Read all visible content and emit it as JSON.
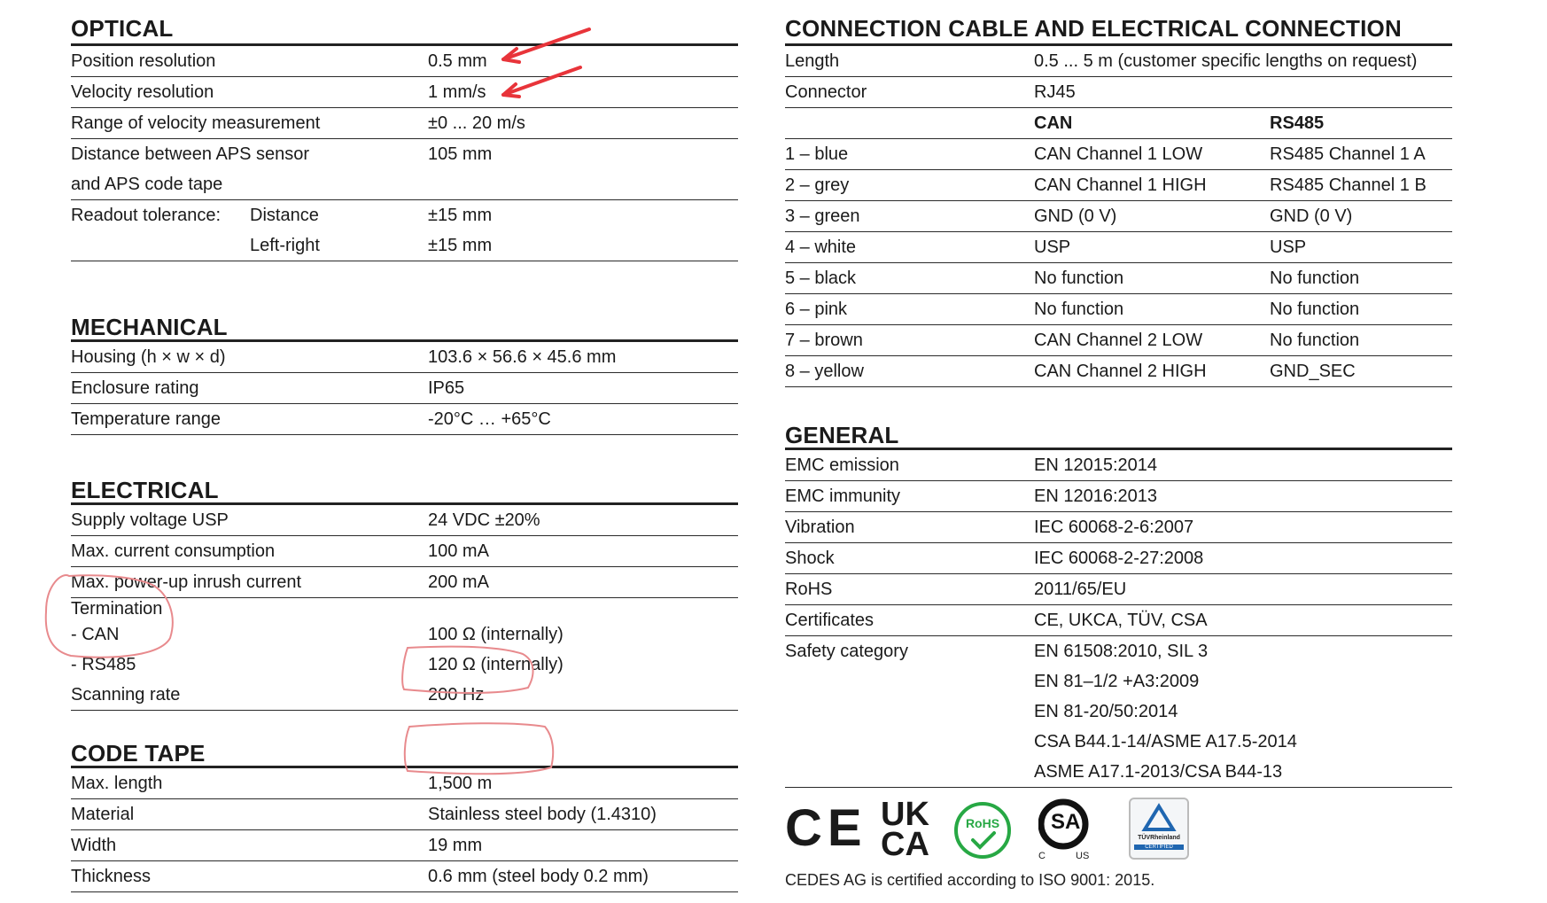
{
  "optical": {
    "title": "OPTICAL",
    "rows": [
      {
        "label": "Position resolution",
        "value": "0.5 mm"
      },
      {
        "label": "Velocity resolution",
        "value": "1 mm/s"
      },
      {
        "label": "Range of velocity measurement",
        "value": "±0 ... 20 m/s"
      },
      {
        "label_line1": "Distance between APS sensor",
        "label_line2": "and APS code tape",
        "value": "105 mm"
      }
    ],
    "readout": {
      "label": "Readout tolerance:",
      "sub1": "Distance",
      "val1": "±15 mm",
      "sub2": "Left-right",
      "val2": "±15 mm"
    }
  },
  "mechanical": {
    "title": "MECHANICAL",
    "rows": [
      {
        "label": "Housing (h × w × d)",
        "value": "103.6 × 56.6 × 45.6 mm"
      },
      {
        "label": "Enclosure rating",
        "value": "IP65"
      },
      {
        "label": "Temperature range",
        "value": "-20°C … +65°C"
      }
    ]
  },
  "electrical": {
    "title": "ELECTRICAL",
    "rows": [
      {
        "label": "Supply voltage USP",
        "value": "24 VDC ±20%"
      },
      {
        "label": "Max. current consumption",
        "value": "100 mA"
      },
      {
        "label": "Max. power-up inrush current",
        "value": "200 mA"
      }
    ],
    "termination": {
      "label": "Termination",
      "can_label": "- CAN",
      "can_value": "100 Ω (internally)",
      "rs_label": "- RS485",
      "rs_value": "120 Ω (internally)"
    },
    "scanning": {
      "label": "Scanning rate",
      "value": "200 Hz"
    }
  },
  "code_tape": {
    "title": "CODE TAPE",
    "rows": [
      {
        "label": "Max. length",
        "value": "1,500 m"
      },
      {
        "label": "Material",
        "value": "Stainless steel body (1.4310)"
      },
      {
        "label": "Width",
        "value": "19 mm"
      },
      {
        "label": "Thickness",
        "value": "0.6 mm (steel body 0.2 mm)"
      }
    ]
  },
  "connection": {
    "title": "CONNECTION CABLE AND ELECTRICAL CONNECTION",
    "length": {
      "label": "Length",
      "value": "0.5 ... 5 m (customer specific lengths on request)"
    },
    "connector": {
      "label": "Connector",
      "value": "RJ45"
    },
    "header": {
      "c2": "CAN",
      "c3": "RS485"
    },
    "pins": [
      {
        "pin": "1 – blue",
        "can": "CAN Channel 1 LOW",
        "rs485": "RS485 Channel 1 A"
      },
      {
        "pin": "2 – grey",
        "can": "CAN Channel 1 HIGH",
        "rs485": "RS485 Channel 1 B"
      },
      {
        "pin": "3 – green",
        "can": "GND (0 V)",
        "rs485": "GND (0 V)"
      },
      {
        "pin": "4 – white",
        "can": "USP",
        "rs485": "USP"
      },
      {
        "pin": "5 – black",
        "can": "No function",
        "rs485": "No function"
      },
      {
        "pin": "6 – pink",
        "can": "No function",
        "rs485": "No function"
      },
      {
        "pin": "7 – brown",
        "can": "CAN Channel 2 LOW",
        "rs485": "No function"
      },
      {
        "pin": "8 – yellow",
        "can": "CAN Channel 2 HIGH",
        "rs485": "GND_SEC"
      }
    ]
  },
  "general": {
    "title": "GENERAL",
    "rows": [
      {
        "label": "EMC emission",
        "value": "EN 12015:2014"
      },
      {
        "label": "EMC immunity",
        "value": "EN 12016:2013"
      },
      {
        "label": "Vibration",
        "value": "IEC 60068-2-6:2007"
      },
      {
        "label": "Shock",
        "value": "IEC 60068-2-27:2008"
      },
      {
        "label": "RoHS",
        "value": "2011/65/EU"
      },
      {
        "label": "Certificates",
        "value": "CE, UKCA, TÜV, CSA"
      }
    ],
    "safety": {
      "label": "Safety category",
      "values": [
        "EN 61508:2010, SIL 3",
        "EN 81–1/2 +A3:2009",
        "EN 81-20/50:2014",
        "CSA B44.1-14/ASME A17.5-2014",
        "ASME A17.1-2013/CSA B44-13"
      ]
    }
  },
  "logos": {
    "ce": "CE",
    "ukca_top": "UK",
    "ukca_bottom": "CA",
    "rohs": "RoHS",
    "csa": "SA",
    "csa_c": "C",
    "csa_us": "US",
    "tuv_line1": "TÜVRheinland",
    "tuv_line2": "CERTIFIED"
  },
  "footer": "CEDES AG is certified according to ISO 9001: 2015.",
  "annotation_color": "#e8343a"
}
